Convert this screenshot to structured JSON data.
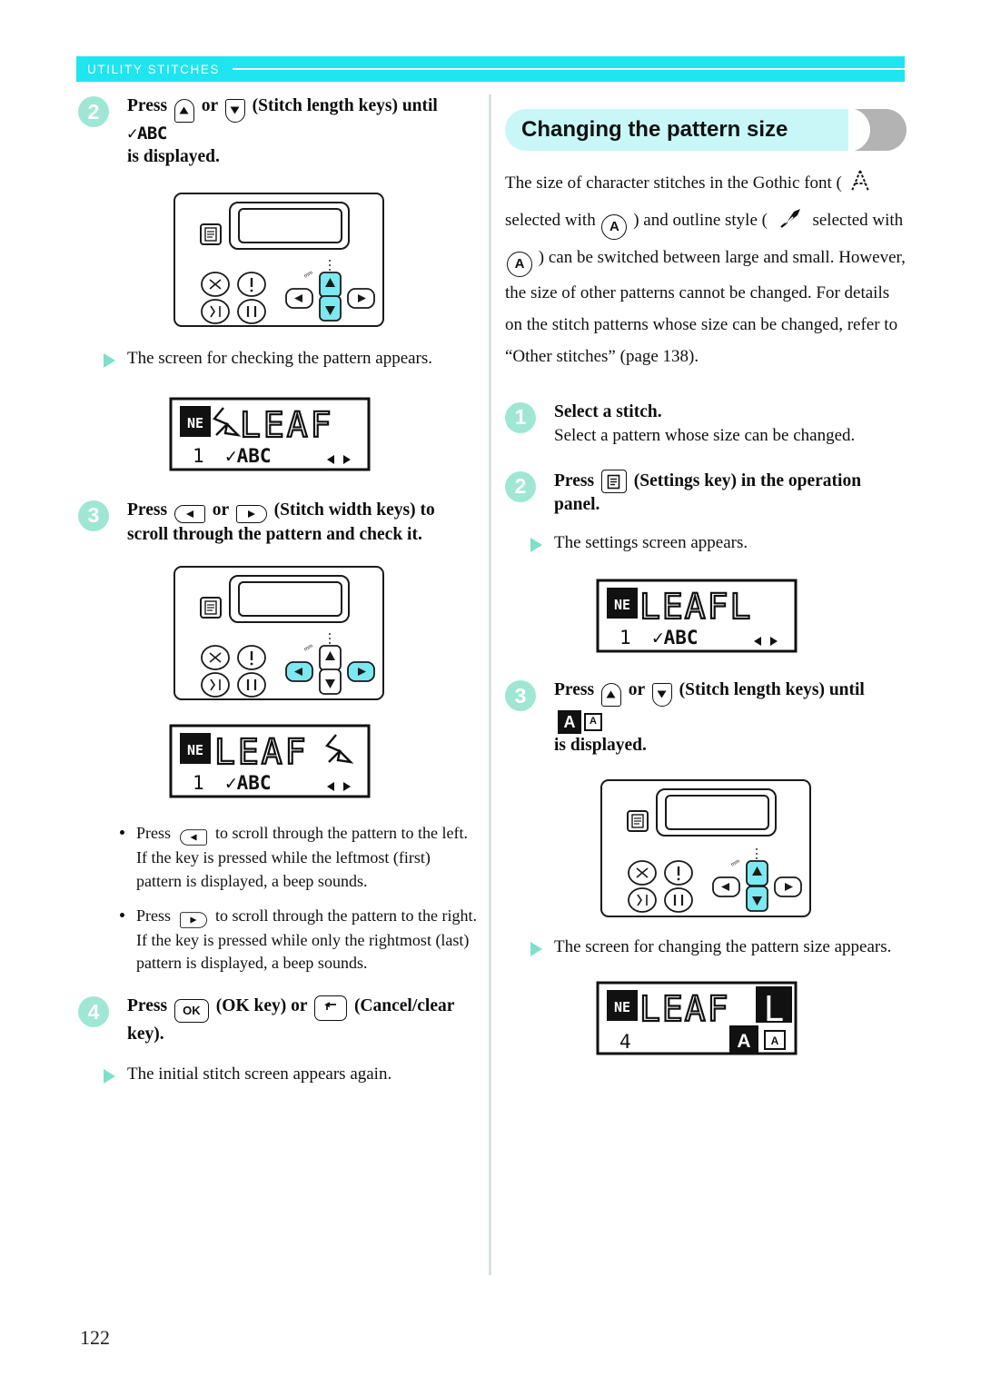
{
  "running_header": {
    "text": "UTILITY STITCHES"
  },
  "page_number": "122",
  "colors": {
    "header_bar": "#1ee5ef",
    "step_badge": "#9fe7d4",
    "pill": "#c9f7f8",
    "crescent": "#b3b3b3",
    "arrow_triangle": "#7fdfc8",
    "divider": "#d6e2dd",
    "key_highlight": "#7ce8f0"
  },
  "left_column": {
    "step2": {
      "number": "2",
      "text_before": "Press",
      "text_mid": "or",
      "text_after": "(Stitch length keys) until",
      "lcd_token": "✓ABC",
      "text_end": "is displayed.",
      "key_up_name": "stitch-length-up-key",
      "key_down_name": "stitch-length-down-key"
    },
    "panel_1": {
      "caption": "operation panel with stitch length keys highlighted",
      "highlight": "up-down"
    },
    "result_1": "The screen for checking the pattern appears.",
    "lcd_1": {
      "top_line": "LEAF",
      "bottom_number": "1",
      "bottom_mode": "✓ABC",
      "cursor_position": "left",
      "arrows": "◀▶"
    },
    "step3": {
      "number": "3",
      "text_before": "Press",
      "text_mid": "or",
      "text_after": "(Stitch width keys) to scroll through the pattern and check it.",
      "key_left_name": "stitch-width-left-key",
      "key_right_name": "stitch-width-right-key"
    },
    "panel_2": {
      "caption": "operation panel with stitch width keys highlighted",
      "highlight": "left-right"
    },
    "lcd_2": {
      "top_line": "LEAF",
      "bottom_number": "1",
      "bottom_mode": "✓ABC",
      "cursor_position": "right",
      "arrows": "◀▶"
    },
    "bullets": [
      {
        "key": "left",
        "text_a": "Press",
        "text_b": "to scroll through the pattern to the left. If the key is pressed while the leftmost (first) pattern is displayed, a beep sounds."
      },
      {
        "key": "right",
        "text_a": "Press",
        "text_b": "to scroll through the pattern to the right. If the key is pressed while only the rightmost (last) pattern is displayed, a beep sounds."
      }
    ],
    "step4": {
      "number": "4",
      "text_before": "Press",
      "ok_label": "OK",
      "text_mid": "(OK key) or",
      "text_after": "(Cancel/clear key).",
      "key_ok_name": "ok-key",
      "key_cancel_name": "cancel-clear-key"
    },
    "result_2": "The initial stitch screen appears again."
  },
  "right_column": {
    "section_title": "Changing the pattern size",
    "intro_paragraph": {
      "part1": "The size of character stitches in the Gothic font (",
      "part2": "selected with",
      "part3": ") and outline style (",
      "part4": "selected with",
      "part5": ") can be switched between large and small. However, the size of other patterns cannot be changed. For details on the stitch patterns whose size can be changed, refer to “Other stitches” (page 138).",
      "circle_label": "A"
    },
    "step1": {
      "number": "1",
      "title": "Select a stitch.",
      "body": "Select a pattern whose size can be changed."
    },
    "step2": {
      "number": "2",
      "text_before": "Press",
      "text_after": "(Settings key) in the operation panel.",
      "key_settings_name": "settings-key"
    },
    "result_1": "The settings screen appears.",
    "lcd_1": {
      "top_line": "LEAFL",
      "bottom_number": "1",
      "bottom_mode": "✓ABC",
      "arrows": "◀▶"
    },
    "step3": {
      "number": "3",
      "text_before": "Press",
      "text_mid": "or",
      "text_after": "(Stitch length keys) until",
      "size_big": "A",
      "size_small": "A",
      "text_end": "is displayed."
    },
    "panel_1": {
      "caption": "operation panel with stitch length keys highlighted",
      "highlight": "up-down"
    },
    "result_2": "The screen for changing the pattern size appears.",
    "lcd_2": {
      "top_line": "LEAFL",
      "bottom_number": "4",
      "size_big": "A",
      "size_small": "A",
      "highlighted_char": "L"
    }
  }
}
